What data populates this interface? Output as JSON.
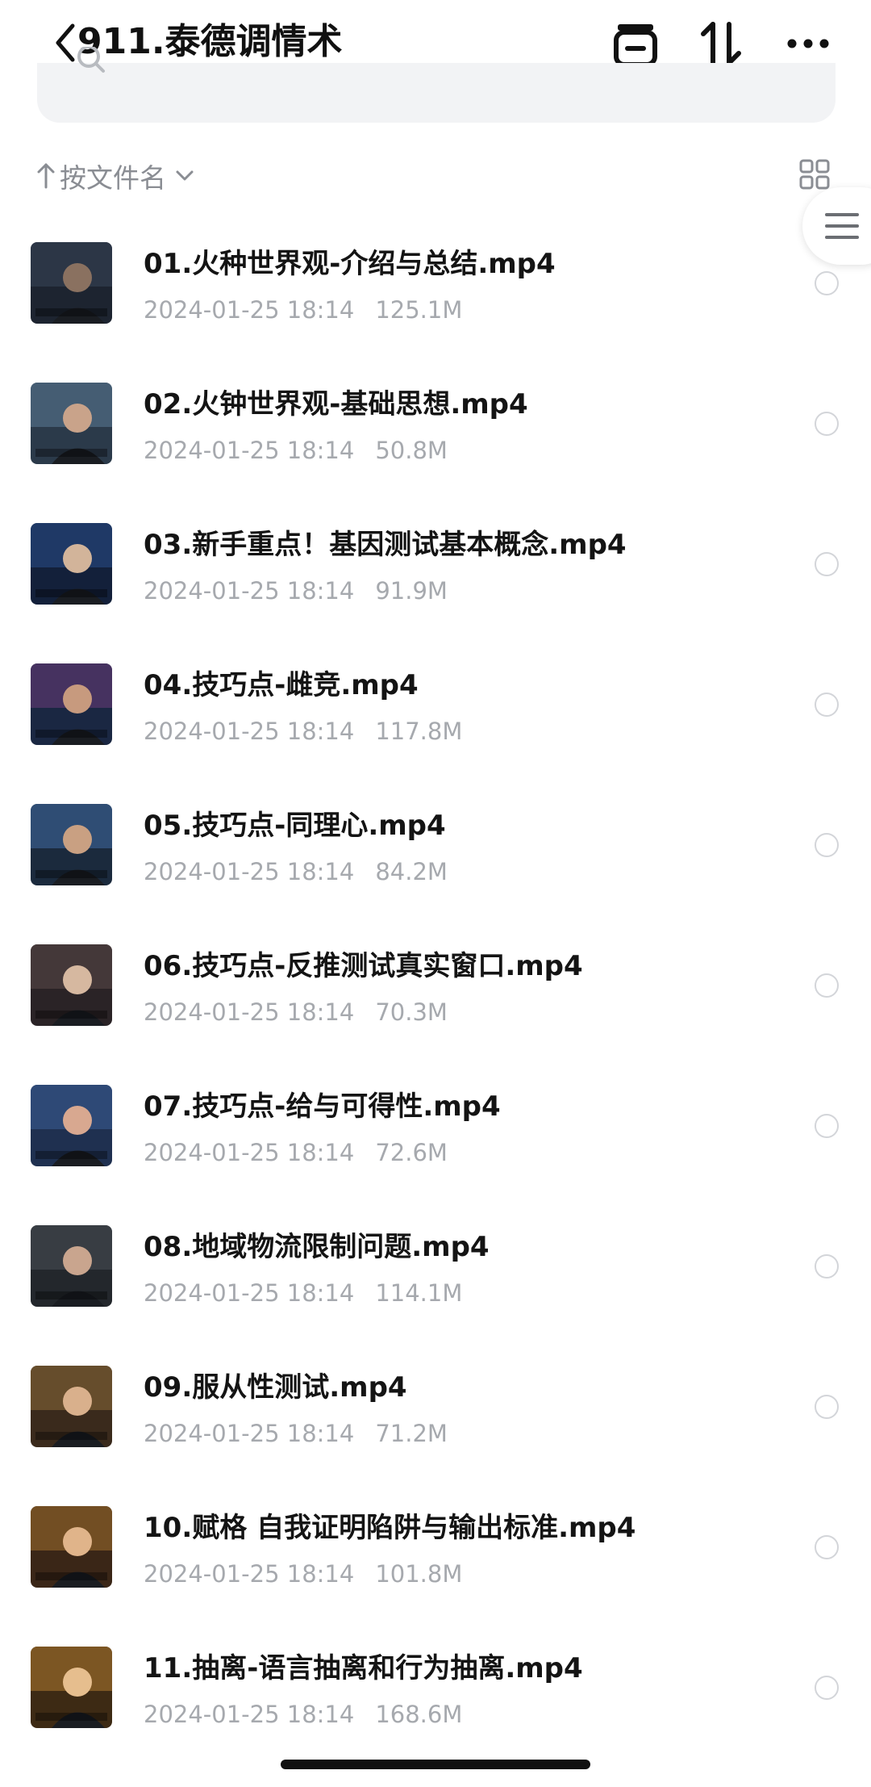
{
  "header": {
    "title": "911.泰德调情术",
    "icons": [
      "back-chevron-icon",
      "inbox-icon",
      "sort-arrows-icon",
      "more-icon"
    ]
  },
  "search": {
    "icon": "search-icon"
  },
  "sort": {
    "label": "按文件名",
    "arrow_icon": "arrow-up-icon",
    "chevron_icon": "chevron-down-icon",
    "view_icon": "grid-view-icon"
  },
  "files": [
    {
      "name": "01.火种世界观-介绍与总结.mp4",
      "date": "2024-01-25 18:14",
      "size": "125.1M"
    },
    {
      "name": "02.火钟世界观-基础思想.mp4",
      "date": "2024-01-25 18:14",
      "size": "50.8M"
    },
    {
      "name": "03.新手重点！基因测试基本概念.mp4",
      "date": "2024-01-25 18:14",
      "size": "91.9M"
    },
    {
      "name": "04.技巧点-雌竞.mp4",
      "date": "2024-01-25 18:14",
      "size": "117.8M"
    },
    {
      "name": "05.技巧点-同理心.mp4",
      "date": "2024-01-25 18:14",
      "size": "84.2M"
    },
    {
      "name": "06.技巧点-反推测试真实窗口.mp4",
      "date": "2024-01-25 18:14",
      "size": "70.3M"
    },
    {
      "name": "07.技巧点-给与可得性.mp4",
      "date": "2024-01-25 18:14",
      "size": "72.6M"
    },
    {
      "name": "08.地域物流限制问题.mp4",
      "date": "2024-01-25 18:14",
      "size": "114.1M"
    },
    {
      "name": "09.服从性测试.mp4",
      "date": "2024-01-25 18:14",
      "size": "71.2M"
    },
    {
      "name": "10.赋格 自我证明陷阱与输出标准.mp4",
      "date": "2024-01-25 18:14",
      "size": "101.8M"
    },
    {
      "name": "11.抽离-语言抽离和行为抽离.mp4",
      "date": "2024-01-25 18:14",
      "size": "168.6M"
    }
  ],
  "colors": {
    "title": "#111111",
    "meta": "#a6a9ae",
    "sort": "#8a8d93",
    "search_bg": "#f2f3f5"
  }
}
